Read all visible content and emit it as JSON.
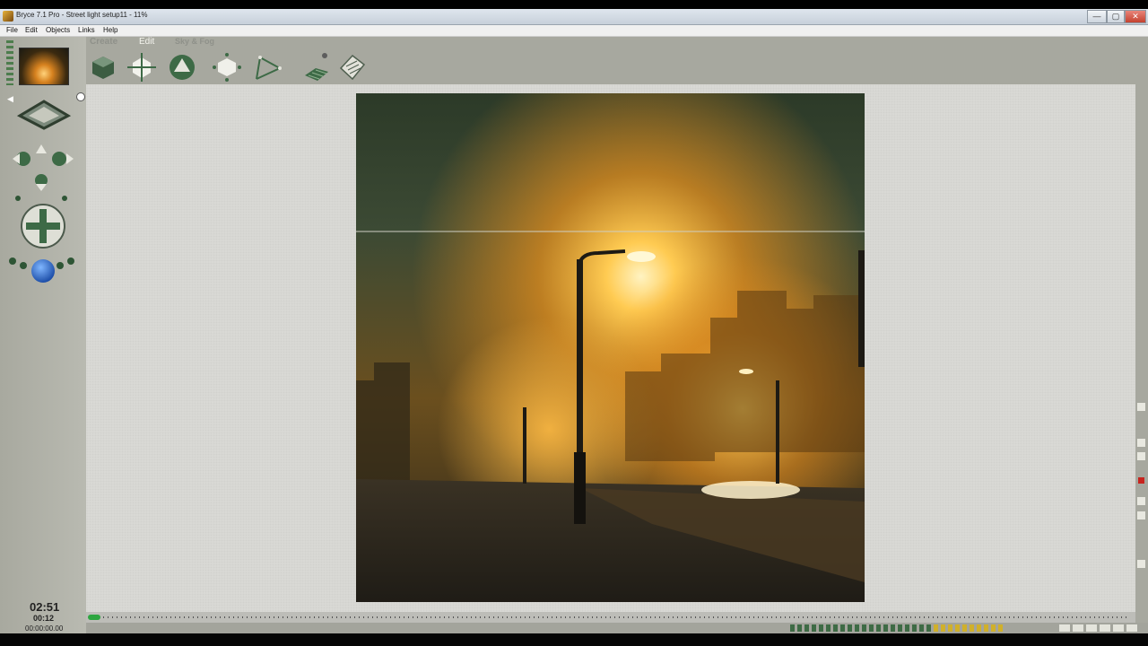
{
  "window": {
    "title": "Bryce 7.1  Pro - Street light setup11 - 11%",
    "controls": {
      "minimize": "—",
      "maximize": "▢",
      "close": "✕"
    }
  },
  "menu": [
    "File",
    "Edit",
    "Objects",
    "Links",
    "Help"
  ],
  "palette_tabs": {
    "create": "Create",
    "edit": "Edit",
    "sky": "Sky & Fog"
  },
  "tools": [
    "cube-tool-icon",
    "light-tool-icon",
    "sphere-tool-icon",
    "object-tool-icon",
    "path-tool-icon",
    "terrain-tool-icon",
    "material-tool-icon"
  ],
  "colors": {
    "panel_bg": "#a7a89f",
    "canvas_bg": "#d9d9d5",
    "accent_blue": "#2f6fd0",
    "accent_green": "#3e6b45",
    "timeline_progress": "#2da640"
  },
  "timers": {
    "elapsed": "02:51",
    "remaining": "00:12",
    "frame_time": "00:00:00.00"
  },
  "timeline": {
    "progress_fraction": 0.01
  }
}
